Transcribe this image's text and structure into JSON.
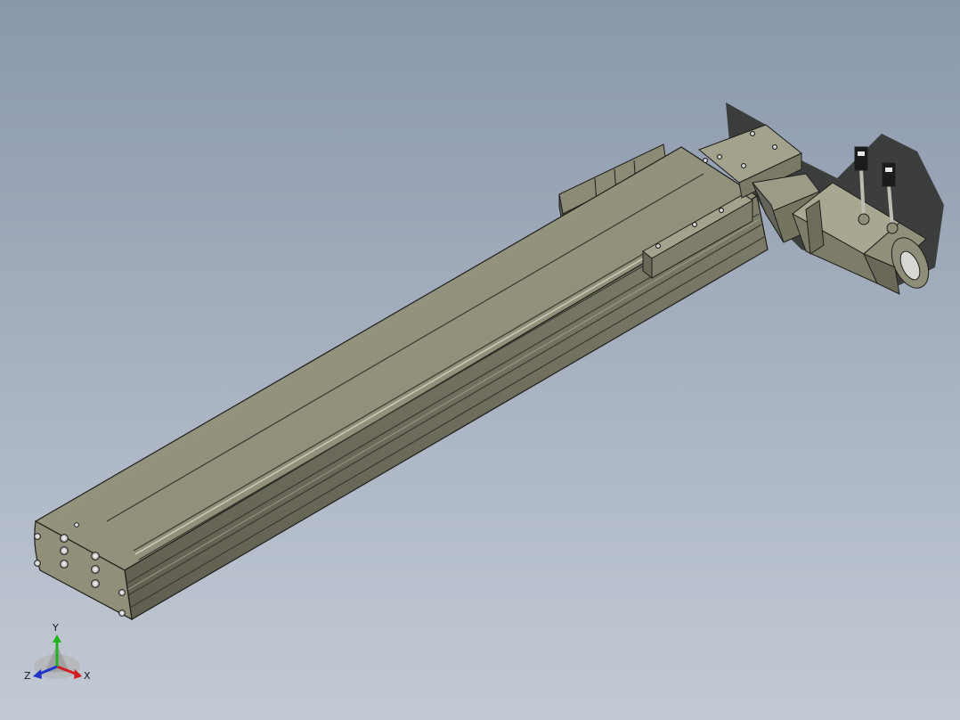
{
  "viewport": {
    "background_top": "#8a98ab",
    "background_bottom": "#c3cad5"
  },
  "model": {
    "body_color": "#8b8a75",
    "body_shadow_color": "#6e6d5c",
    "edge_color": "#1f1f1c"
  },
  "triad": {
    "x_label": "X",
    "y_label": "Y",
    "z_label": "Z",
    "x_color": "#d21e1e",
    "y_color": "#22b422",
    "z_color": "#2035c8"
  }
}
